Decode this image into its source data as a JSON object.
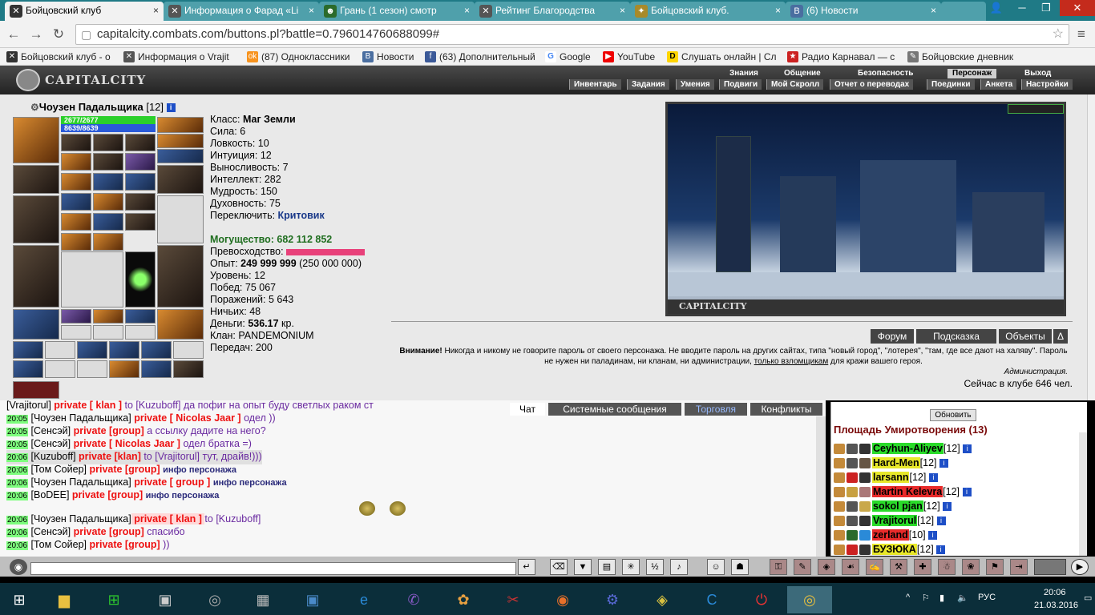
{
  "browser": {
    "tabs": [
      {
        "label": "Бойцовский клуб",
        "active": true
      },
      {
        "label": "Информация о Фарад «Li"
      },
      {
        "label": "Грань (1 сезон) смотр"
      },
      {
        "label": "Рейтинг Благородства"
      },
      {
        "label": "Бойцовский клуб."
      },
      {
        "label": "(6) Новости"
      }
    ],
    "url": "capitalcity.combats.com/buttons.pl?battle=0.796014760688099#",
    "bookmarks": [
      "Бойцовский клуб - о",
      "Информация о Vrajit",
      "(87) Одноклассники",
      "Новости",
      "(63) Дополнительный",
      "Google",
      "YouTube",
      "Слушать онлайн | Сл",
      "Радио Карнавал — с",
      "Бойцовские дневник"
    ]
  },
  "game": {
    "logo": "CAPITALCITY",
    "top_menu": [
      "Знания",
      "Общение",
      "Безопасность",
      "Персонаж",
      "Выход"
    ],
    "top_menu_selected": "Персонаж",
    "sub_menu": [
      "Инвентарь",
      "Задания",
      "Умения",
      "Подвиги",
      "Мой Скролл",
      "Отчет о переводах",
      "Поединки",
      "Анкета",
      "Настройки"
    ],
    "character": {
      "name": "Чоузен Падальщика",
      "level_badge": "[12]",
      "hp": "2677/2677",
      "mana": "8639/8639"
    },
    "stats": {
      "class_label": "Класс: ",
      "class_value": "Маг Земли",
      "strength": "Сила: 6",
      "agility": "Ловкость: 10",
      "intuition": "Интуиция: 12",
      "endurance": "Выносливость: 7",
      "intellect": "Интеллект: 282",
      "wisdom": "Мудрость: 150",
      "spirit": "Духовность: 75",
      "switch_label": "Переключить: ",
      "switch_value": "Критовик",
      "power": "Могущество: 682 112 852",
      "superiority": "Превосходство:",
      "exp_label": "Опыт: ",
      "exp_value": "249 999 999",
      "exp_next": " (250 000 000)",
      "level": "Уровень: 12",
      "wins": "Побед: 75 067",
      "losses": "Поражений: 5 643",
      "draws": "Ничьих: 48",
      "money_label": "Деньги: ",
      "money_value": "536.17",
      "money_unit": " кр.",
      "clan": "Клан: PANDEMONIUM",
      "transfers": "Передач: 200"
    },
    "scene_label": "CAPITALCITY",
    "buttons": [
      "Форум",
      "Подсказка",
      "Объекты",
      "Δ"
    ],
    "warning_bold": "Внимание!",
    "warning_text": " Никогда и никому не говорите пароль от своего персонажа. Не вводите пароль на других сайтах, типа \"новый город\", \"лотерея\", \"там, где все дают на халяву\". Пароль не нужен ни паладинам, ни кланам, ни администрации, ",
    "warning_link": "только взломщикам",
    "warning_tail": " для кражи вашего героя.",
    "warning_sign": "Администрация.",
    "online": "Сейчас в клубе 646 чел."
  },
  "chat": {
    "tabs": [
      "Чат",
      "Системные сообщения",
      "Торговля",
      "Конфликты"
    ],
    "lines": [
      {
        "ts": "",
        "nm": "[Vrajitorul]",
        "pv": " private [ klan ] ",
        "msg": "to [Kuzuboff] да пофиг на опыт буду светлых раком ст"
      },
      {
        "ts": "20:05",
        "nm": " [Чоузен Падальщика]",
        "pv": " private [ Nicolas Jaar ] ",
        "msg": "одел ))"
      },
      {
        "ts": "20:05",
        "nm": " [Сенсэй]",
        "pv": " private [group] ",
        "msg": "а ссылку дадите на него?"
      },
      {
        "ts": "20:05",
        "nm": " [Сенсэй]",
        "pv": " private [ Nicolas Jaar ] ",
        "msg": "одел братка =)"
      },
      {
        "ts": "20:06",
        "nm": " [Kuzuboff]",
        "pv": " private [klan] ",
        "msg": "to [Vrajitorul] тут, драйв!)))"
      },
      {
        "ts": "20:06",
        "nm": " [Том Сойер]",
        "pv": " private [group] ",
        "msg": "инфо персонажа"
      },
      {
        "ts": "20:06",
        "nm": " [Чоузен Падальщика]",
        "pv": " private [ group ] ",
        "msg": "инфо персонажа"
      },
      {
        "ts": "20:06",
        "nm": " [BoDEE]",
        "pv": " private [group] ",
        "msg": "инфо персонажа"
      },
      {
        "ts": "",
        "nm": "",
        "pv": "",
        "msg": ""
      },
      {
        "ts": "20:06",
        "nm": " [Чоузен Падальщика]",
        "pv": " private [ klan ] ",
        "msg": "to [Kuzuboff]"
      },
      {
        "ts": "20:06",
        "nm": " [Сенсэй]",
        "pv": " private [group] ",
        "msg": "спасибо"
      },
      {
        "ts": "20:06",
        "nm": " [Том Сойер]",
        "pv": " private [group] ",
        "msg": "))"
      }
    ]
  },
  "room": {
    "refresh": "Обновить",
    "title": "Площадь Умиротворения (13)",
    "players": [
      {
        "name": "Ceyhun-Aliyev",
        "lvl": "[12]",
        "color": "#2adb2a"
      },
      {
        "name": "Hard-Men",
        "lvl": "[12]",
        "color": "#e8e82a"
      },
      {
        "name": "larsann",
        "lvl": "[12]",
        "color": "#e8e82a"
      },
      {
        "name": "Martin Kelevra",
        "lvl": "[12]",
        "color": "#e82a2a"
      },
      {
        "name": "sokol pjan",
        "lvl": "[12]",
        "color": "#2adb2a"
      },
      {
        "name": "Vrajitorul",
        "lvl": "[12]",
        "color": "#2adb2a"
      },
      {
        "name": "zerland",
        "lvl": "[10]",
        "color": "#e82a2a"
      },
      {
        "name": "БУЗЮКА",
        "lvl": "[12]",
        "color": "#e8e82a"
      }
    ]
  },
  "taskbar": {
    "lang": "РУС",
    "time": "20:06",
    "date": "21.03.2016"
  }
}
